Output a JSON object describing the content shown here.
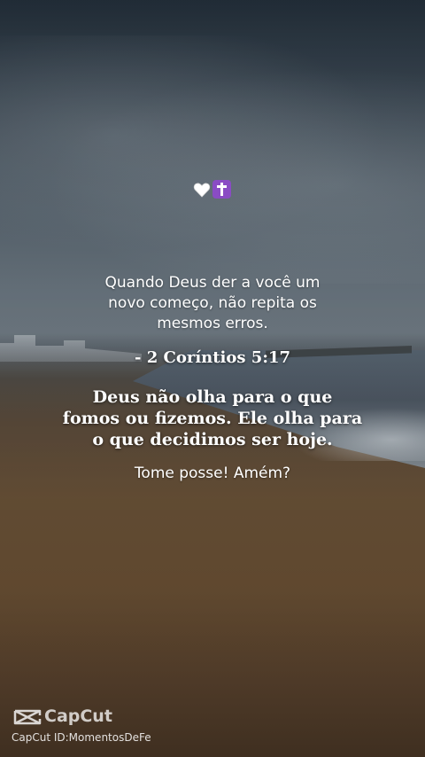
{
  "emoji": {
    "heart": "🤍",
    "cross": "✝️"
  },
  "post": {
    "quote": "Quando Deus der a você um\nnovo começo, não repita os\nmesmos erros.",
    "reference": "- 2 Coríntios 5:17",
    "message": "Deus não olha para o que\nfomos ou fizemos. Ele olha para\no que decidimos ser hoje.",
    "call_to_action": "Tome posse! Amém?"
  },
  "watermark": {
    "brand": "CapCut",
    "id_text": "CapCut ID:MomentosDeFe"
  },
  "colors": {
    "cross_bg": "#8a4cc4",
    "text": "#ffffff"
  }
}
